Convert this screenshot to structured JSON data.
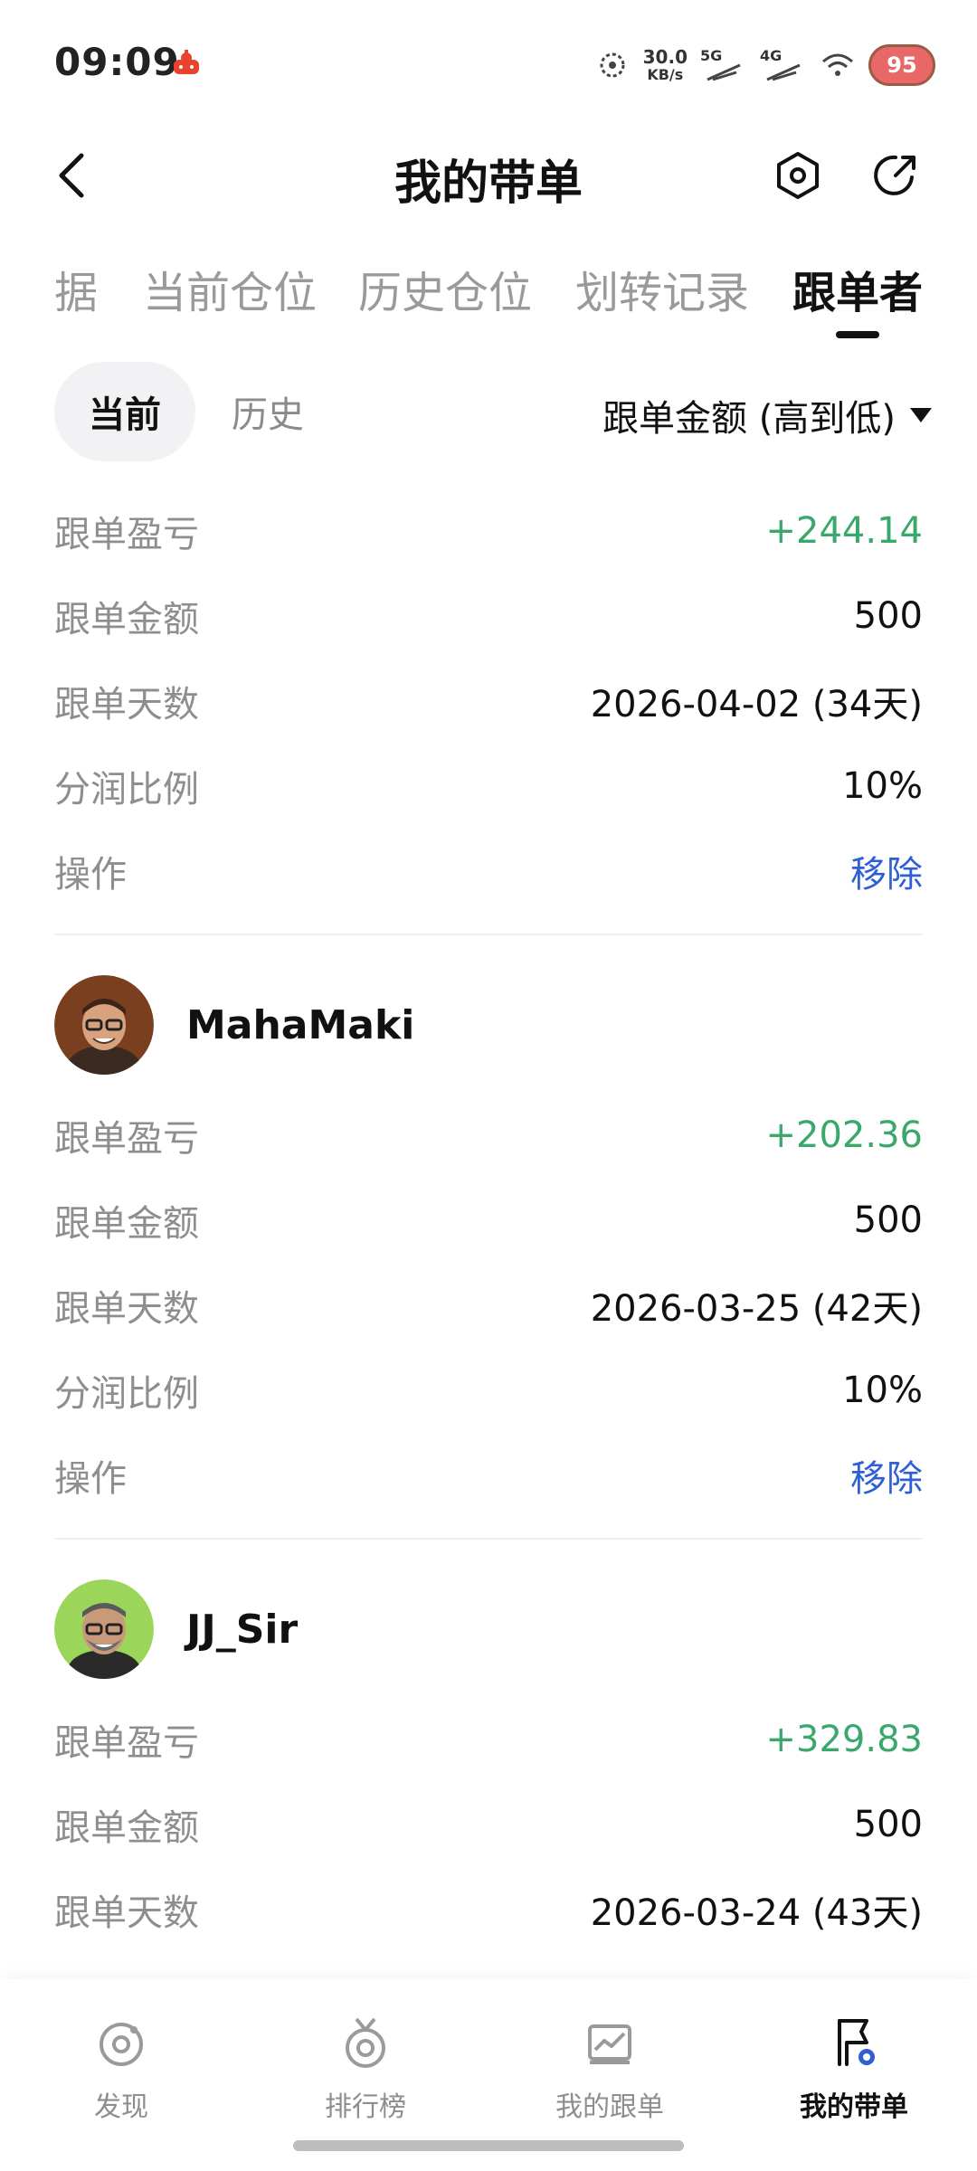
{
  "status_bar": {
    "time": "09:09",
    "speed_value": "30.0",
    "speed_unit": "KB/s",
    "net1": "5G",
    "net2": "4G",
    "battery": "95"
  },
  "header": {
    "title": "我的带单",
    "back_icon": "chevron-left-icon",
    "settings_icon": "hexagon-settings-icon",
    "share_icon": "share-arrow-icon"
  },
  "tabs": [
    {
      "label": "据",
      "active": false
    },
    {
      "label": "当前仓位",
      "active": false
    },
    {
      "label": "历史仓位",
      "active": false
    },
    {
      "label": "划转记录",
      "active": false
    },
    {
      "label": "跟单者",
      "active": true
    }
  ],
  "filter": {
    "current_label": "当前",
    "history_label": "历史",
    "sort_label": "跟单金额 (高到低)"
  },
  "followers": [
    {
      "name": "",
      "rows": [
        {
          "k": "跟单盈亏",
          "v": "+244.14"
        },
        {
          "k": "跟单金额",
          "v": "500"
        },
        {
          "k": "跟单天数",
          "v": "2026-04-02 (34天)"
        },
        {
          "k": "分润比例",
          "v": "10%"
        },
        {
          "k": "操作",
          "v": "移除"
        }
      ]
    },
    {
      "name": "MahaMaki",
      "rows": [
        {
          "k": "跟单盈亏",
          "v": "+202.36"
        },
        {
          "k": "跟单金额",
          "v": "500"
        },
        {
          "k": "跟单天数",
          "v": "2026-03-25 (42天)"
        },
        {
          "k": "分润比例",
          "v": "10%"
        },
        {
          "k": "操作",
          "v": "移除"
        }
      ]
    },
    {
      "name": "JJ_Sir",
      "rows": [
        {
          "k": "跟单盈亏",
          "v": "+329.83"
        },
        {
          "k": "跟单金额",
          "v": "500"
        },
        {
          "k": "跟单天数",
          "v": "2026-03-24 (43天)"
        }
      ]
    }
  ],
  "bottom_nav": [
    {
      "label": "发现",
      "icon": "discover-icon",
      "active": false
    },
    {
      "label": "排行榜",
      "icon": "medal-icon",
      "active": false
    },
    {
      "label": "我的跟单",
      "icon": "chart-card-icon",
      "active": false
    },
    {
      "label": "我的带单",
      "icon": "flag-lead-icon",
      "active": true
    }
  ],
  "colors": {
    "profit": "#3aa86d",
    "link": "#2f5fd6",
    "muted": "#8e8e8e",
    "active_text": "#111111"
  }
}
